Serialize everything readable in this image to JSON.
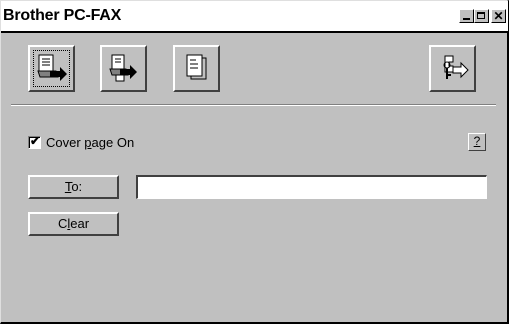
{
  "window": {
    "title": "Brother PC-FAX"
  },
  "toolbar": {
    "buttons": [
      {
        "icon": "send-fax-icon"
      },
      {
        "icon": "receive-fax-icon"
      },
      {
        "icon": "document-icon"
      },
      {
        "icon": "exit-icon"
      }
    ]
  },
  "options": {
    "cover_page_pre": "Cover ",
    "cover_page_u": "p",
    "cover_page_post": "age On",
    "cover_page_checked": true,
    "help_label": "?"
  },
  "recipient": {
    "to_u": "T",
    "to_post": "o:",
    "to_value": "",
    "clear_pre": "C",
    "clear_u": "l",
    "clear_post": "ear"
  }
}
